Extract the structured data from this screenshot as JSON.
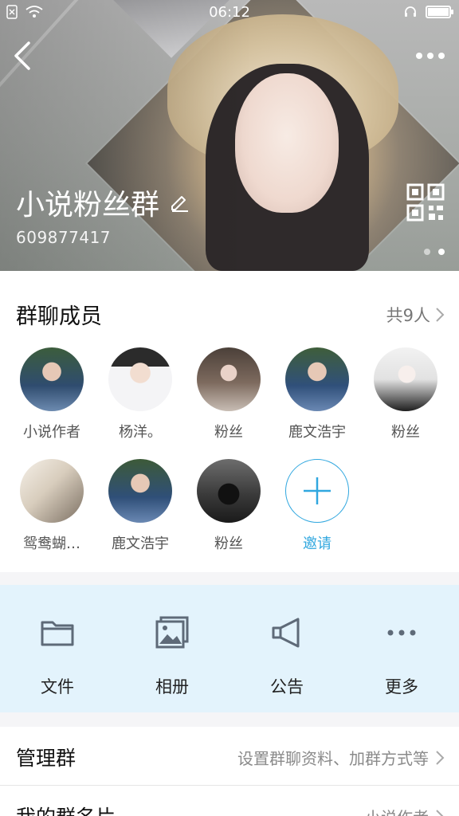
{
  "status_bar": {
    "time": "06:12"
  },
  "group": {
    "name": "小说粉丝群",
    "id": "609877417"
  },
  "members": {
    "title": "群聊成员",
    "count_label": "共9人",
    "list": [
      {
        "name": "小说作者"
      },
      {
        "name": "杨洋。"
      },
      {
        "name": "粉丝"
      },
      {
        "name": "鹿文浩宇"
      },
      {
        "name": "粉丝"
      },
      {
        "name": "鸳鸯蝴…"
      },
      {
        "name": "鹿文浩宇"
      },
      {
        "name": "粉丝"
      }
    ],
    "invite_label": "邀请"
  },
  "actions": [
    {
      "label": "文件",
      "icon": "folder-icon"
    },
    {
      "label": "相册",
      "icon": "album-icon"
    },
    {
      "label": "公告",
      "icon": "megaphone-icon"
    },
    {
      "label": "更多",
      "icon": "more-dots-icon"
    }
  ],
  "settings": [
    {
      "key": "管理群",
      "value": "设置群聊资料、加群方式等"
    },
    {
      "key": "我的群名片",
      "value": "小说作者"
    }
  ],
  "colors": {
    "accent": "#30a7df",
    "actions_bg": "#e3f3fc"
  }
}
